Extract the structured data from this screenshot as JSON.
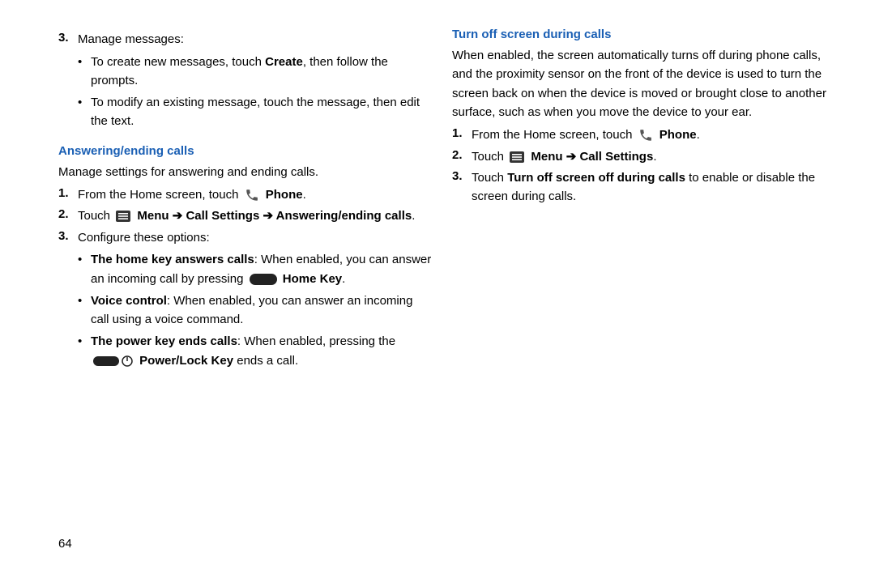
{
  "pageNumber": "64",
  "left": {
    "top": {
      "num": "3.",
      "lead": "Manage messages:",
      "bullets": [
        {
          "pre": "To create new messages, touch ",
          "bold": "Create",
          "post": ", then follow the prompts."
        },
        {
          "pre": "To modify an existing message, touch the message, then edit the text.",
          "bold": "",
          "post": ""
        }
      ]
    },
    "heading": "Answering/ending calls",
    "intro": "Manage settings for answering and ending calls.",
    "steps": {
      "s1": {
        "num": "1.",
        "pre": "From the Home screen, touch ",
        "bold": "Phone",
        "post": "."
      },
      "s2": {
        "num": "2.",
        "pre": "Touch ",
        "b1": "Menu",
        "b2": "Call Settings",
        "b3": "Answering/ending calls",
        "post": "."
      },
      "s3": {
        "num": "3.",
        "text": "Configure these options:"
      }
    },
    "opts": {
      "o1": {
        "b": "The home key answers calls",
        "pre": ": When enabled, you can answer an incoming call by pressing ",
        "b2": "Home Key",
        "post": "."
      },
      "o2": {
        "b": "Voice control",
        "text": ": When enabled, you can answer an incoming call using a voice command."
      },
      "o3": {
        "b": "The power key ends calls",
        "pre": ": When enabled, pressing the ",
        "b2": "Power/Lock Key",
        "post": " ends a call."
      }
    }
  },
  "right": {
    "heading": "Turn off screen during calls",
    "para": "When enabled, the screen automatically turns off during phone calls, and the proximity sensor on the front of the device is used to turn the screen back on when the device is moved or brought close to another surface, such as when you move the device to your ear.",
    "s1": {
      "num": "1.",
      "pre": "From the Home screen, touch ",
      "bold": "Phone",
      "post": "."
    },
    "s2": {
      "num": "2.",
      "pre": "Touch ",
      "b1": "Menu",
      "b2": "Call Settings",
      "post": "."
    },
    "s3": {
      "num": "3.",
      "pre": "Touch ",
      "b": "Turn off screen off during calls",
      "post": " to enable or disable the screen during calls."
    }
  }
}
